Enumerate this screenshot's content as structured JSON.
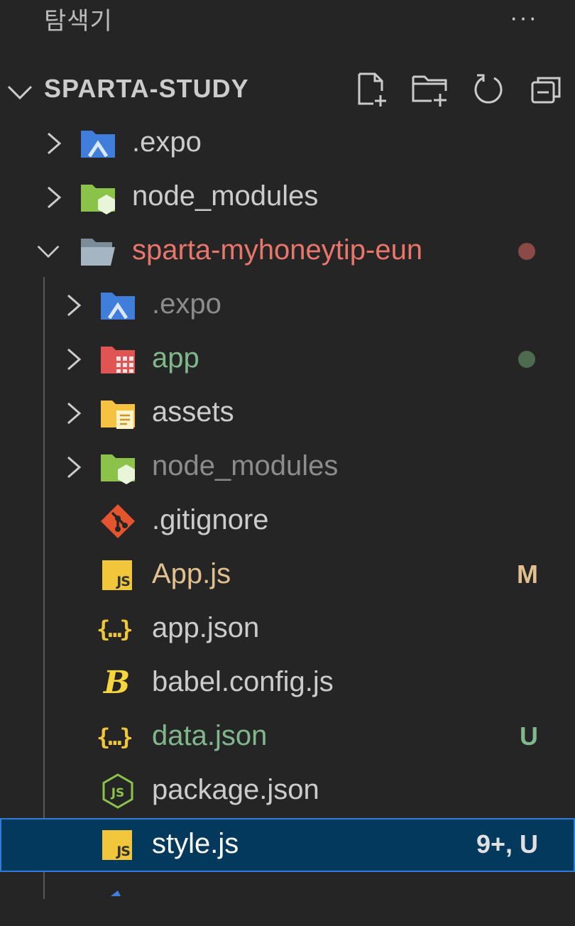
{
  "header": {
    "title": "탐색기",
    "more_label": "···"
  },
  "section": {
    "title": "SPARTA-STUDY",
    "actions": [
      "new-file-icon",
      "new-folder-icon",
      "refresh-icon",
      "collapse-all-icon"
    ]
  },
  "tree": [
    {
      "label": ".expo",
      "icon": "expo-folder-icon",
      "expanded": false,
      "depth": 0,
      "color": "#cccccc"
    },
    {
      "label": "node_modules",
      "icon": "node-folder-icon",
      "expanded": false,
      "depth": 0,
      "color": "#cccccc"
    },
    {
      "label": "sparta-myhoneytip-eun",
      "icon": "folder-open-icon",
      "expanded": true,
      "depth": 0,
      "color": "#e8766a",
      "dot_color": "#8b4a48"
    },
    {
      "label": ".expo",
      "icon": "expo-folder-icon",
      "expanded": false,
      "depth": 1,
      "color": "#8c8c8c"
    },
    {
      "label": "app",
      "icon": "app-folder-icon",
      "expanded": false,
      "depth": 1,
      "color": "#81b88b",
      "dot_color": "#4e6b50"
    },
    {
      "label": "assets",
      "icon": "assets-folder-icon",
      "expanded": false,
      "depth": 1,
      "color": "#cccccc"
    },
    {
      "label": "node_modules",
      "icon": "node-folder-icon",
      "expanded": false,
      "depth": 1,
      "color": "#8c8c8c"
    },
    {
      "label": ".gitignore",
      "icon": "git-icon",
      "depth": 1,
      "color": "#cccccc"
    },
    {
      "label": "App.js",
      "icon": "js-file-icon",
      "depth": 1,
      "color": "#e2c08d",
      "badge": "M",
      "badge_color": "#e2c08d"
    },
    {
      "label": "app.json",
      "icon": "json-file-icon",
      "depth": 1,
      "color": "#cccccc"
    },
    {
      "label": "babel.config.js",
      "icon": "babel-icon",
      "depth": 1,
      "color": "#cccccc"
    },
    {
      "label": "data.json",
      "icon": "json-file-icon",
      "depth": 1,
      "color": "#81b88b",
      "badge": "U",
      "badge_color": "#81b88b"
    },
    {
      "label": "package.json",
      "icon": "nodejs-icon",
      "depth": 1,
      "color": "#cccccc"
    },
    {
      "label": "style.js",
      "icon": "js-file-icon",
      "depth": 1,
      "color": "#ffffff",
      "badge": "9+, U",
      "badge_color": "#e0e0e0",
      "selected": true
    }
  ],
  "colors": {
    "background": "#252526",
    "selection": "#04395e",
    "selection_border": "#2f7bd6"
  }
}
